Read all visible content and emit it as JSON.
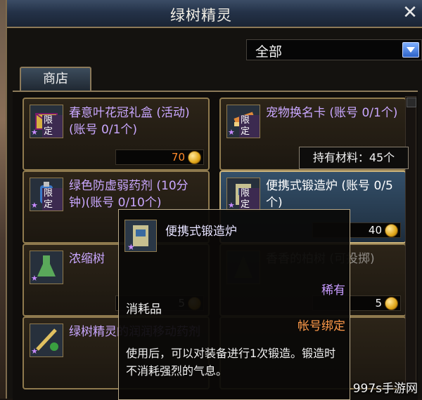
{
  "window": {
    "title": "绿树精灵"
  },
  "filter": {
    "selected": "全部"
  },
  "tabs": [
    {
      "label": "商店"
    }
  ],
  "items": [
    {
      "name": "春意叶花冠礼盒 (活动)(账号 0/1个)",
      "badge": "限定",
      "price": "70"
    },
    {
      "name": "宠物换名卡 (账号 0/1个)",
      "badge": "限定",
      "price": ""
    },
    {
      "name": "绿色防虚弱药剂 (10分钟)(账号 0/10个)",
      "badge": "限定",
      "price": ""
    },
    {
      "name": "便携式锻造炉 (账号 0/5个)",
      "badge": "限定",
      "price": "40"
    },
    {
      "name": "浓缩树",
      "badge": "",
      "price": "5"
    },
    {
      "name": "香香的柏树 (可投掷)",
      "badge": "",
      "price": "5"
    },
    {
      "name": "绿树精灵的润润移动药剂",
      "badge": "",
      "price": ""
    }
  ],
  "material_tooltip": {
    "text": "持有材料：45个"
  },
  "item_tooltip": {
    "title": "便携式锻造炉",
    "rarity": "稀有",
    "type": "消耗品",
    "binding": "帐号绑定",
    "description": "使用后，可以对装备进行1次锻造。锻造时不消耗强烈的气息。"
  },
  "watermark": "997s手游网",
  "colors": {
    "accent_purple": "#c9a7ff",
    "price_orange": "#ff8a2a",
    "bind_orange": "#ff9a4a"
  }
}
